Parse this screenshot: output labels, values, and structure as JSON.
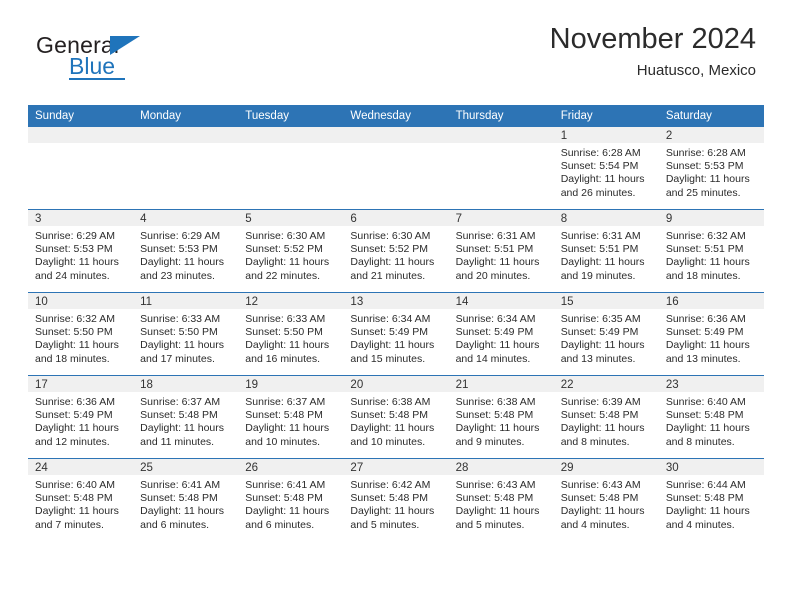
{
  "logo": {
    "word_one": "General",
    "word_two": "Blue",
    "flag_icon": "triangle-flag-icon",
    "accent_color": "#1f74bb"
  },
  "header": {
    "month_title": "November 2024",
    "location": "Huatusco, Mexico"
  },
  "calendar": {
    "header_bg": "#2d74b5",
    "daynum_band_bg": "#f0f0f0",
    "weekdays": [
      "Sunday",
      "Monday",
      "Tuesday",
      "Wednesday",
      "Thursday",
      "Friday",
      "Saturday"
    ],
    "labels": {
      "sunrise": "Sunrise:",
      "sunset": "Sunset:",
      "daylight": "Daylight:"
    },
    "weeks": [
      [
        {
          "day": "",
          "blank": true
        },
        {
          "day": "",
          "blank": true
        },
        {
          "day": "",
          "blank": true
        },
        {
          "day": "",
          "blank": true
        },
        {
          "day": "",
          "blank": true
        },
        {
          "day": "1",
          "sunrise": "Sunrise: 6:28 AM",
          "sunset": "Sunset: 5:54 PM",
          "daylight_1": "Daylight: 11 hours",
          "daylight_2": "and 26 minutes."
        },
        {
          "day": "2",
          "sunrise": "Sunrise: 6:28 AM",
          "sunset": "Sunset: 5:53 PM",
          "daylight_1": "Daylight: 11 hours",
          "daylight_2": "and 25 minutes."
        }
      ],
      [
        {
          "day": "3",
          "sunrise": "Sunrise: 6:29 AM",
          "sunset": "Sunset: 5:53 PM",
          "daylight_1": "Daylight: 11 hours",
          "daylight_2": "and 24 minutes."
        },
        {
          "day": "4",
          "sunrise": "Sunrise: 6:29 AM",
          "sunset": "Sunset: 5:53 PM",
          "daylight_1": "Daylight: 11 hours",
          "daylight_2": "and 23 minutes."
        },
        {
          "day": "5",
          "sunrise": "Sunrise: 6:30 AM",
          "sunset": "Sunset: 5:52 PM",
          "daylight_1": "Daylight: 11 hours",
          "daylight_2": "and 22 minutes."
        },
        {
          "day": "6",
          "sunrise": "Sunrise: 6:30 AM",
          "sunset": "Sunset: 5:52 PM",
          "daylight_1": "Daylight: 11 hours",
          "daylight_2": "and 21 minutes."
        },
        {
          "day": "7",
          "sunrise": "Sunrise: 6:31 AM",
          "sunset": "Sunset: 5:51 PM",
          "daylight_1": "Daylight: 11 hours",
          "daylight_2": "and 20 minutes."
        },
        {
          "day": "8",
          "sunrise": "Sunrise: 6:31 AM",
          "sunset": "Sunset: 5:51 PM",
          "daylight_1": "Daylight: 11 hours",
          "daylight_2": "and 19 minutes."
        },
        {
          "day": "9",
          "sunrise": "Sunrise: 6:32 AM",
          "sunset": "Sunset: 5:51 PM",
          "daylight_1": "Daylight: 11 hours",
          "daylight_2": "and 18 minutes."
        }
      ],
      [
        {
          "day": "10",
          "sunrise": "Sunrise: 6:32 AM",
          "sunset": "Sunset: 5:50 PM",
          "daylight_1": "Daylight: 11 hours",
          "daylight_2": "and 18 minutes."
        },
        {
          "day": "11",
          "sunrise": "Sunrise: 6:33 AM",
          "sunset": "Sunset: 5:50 PM",
          "daylight_1": "Daylight: 11 hours",
          "daylight_2": "and 17 minutes."
        },
        {
          "day": "12",
          "sunrise": "Sunrise: 6:33 AM",
          "sunset": "Sunset: 5:50 PM",
          "daylight_1": "Daylight: 11 hours",
          "daylight_2": "and 16 minutes."
        },
        {
          "day": "13",
          "sunrise": "Sunrise: 6:34 AM",
          "sunset": "Sunset: 5:49 PM",
          "daylight_1": "Daylight: 11 hours",
          "daylight_2": "and 15 minutes."
        },
        {
          "day": "14",
          "sunrise": "Sunrise: 6:34 AM",
          "sunset": "Sunset: 5:49 PM",
          "daylight_1": "Daylight: 11 hours",
          "daylight_2": "and 14 minutes."
        },
        {
          "day": "15",
          "sunrise": "Sunrise: 6:35 AM",
          "sunset": "Sunset: 5:49 PM",
          "daylight_1": "Daylight: 11 hours",
          "daylight_2": "and 13 minutes."
        },
        {
          "day": "16",
          "sunrise": "Sunrise: 6:36 AM",
          "sunset": "Sunset: 5:49 PM",
          "daylight_1": "Daylight: 11 hours",
          "daylight_2": "and 13 minutes."
        }
      ],
      [
        {
          "day": "17",
          "sunrise": "Sunrise: 6:36 AM",
          "sunset": "Sunset: 5:49 PM",
          "daylight_1": "Daylight: 11 hours",
          "daylight_2": "and 12 minutes."
        },
        {
          "day": "18",
          "sunrise": "Sunrise: 6:37 AM",
          "sunset": "Sunset: 5:48 PM",
          "daylight_1": "Daylight: 11 hours",
          "daylight_2": "and 11 minutes."
        },
        {
          "day": "19",
          "sunrise": "Sunrise: 6:37 AM",
          "sunset": "Sunset: 5:48 PM",
          "daylight_1": "Daylight: 11 hours",
          "daylight_2": "and 10 minutes."
        },
        {
          "day": "20",
          "sunrise": "Sunrise: 6:38 AM",
          "sunset": "Sunset: 5:48 PM",
          "daylight_1": "Daylight: 11 hours",
          "daylight_2": "and 10 minutes."
        },
        {
          "day": "21",
          "sunrise": "Sunrise: 6:38 AM",
          "sunset": "Sunset: 5:48 PM",
          "daylight_1": "Daylight: 11 hours",
          "daylight_2": "and 9 minutes."
        },
        {
          "day": "22",
          "sunrise": "Sunrise: 6:39 AM",
          "sunset": "Sunset: 5:48 PM",
          "daylight_1": "Daylight: 11 hours",
          "daylight_2": "and 8 minutes."
        },
        {
          "day": "23",
          "sunrise": "Sunrise: 6:40 AM",
          "sunset": "Sunset: 5:48 PM",
          "daylight_1": "Daylight: 11 hours",
          "daylight_2": "and 8 minutes."
        }
      ],
      [
        {
          "day": "24",
          "sunrise": "Sunrise: 6:40 AM",
          "sunset": "Sunset: 5:48 PM",
          "daylight_1": "Daylight: 11 hours",
          "daylight_2": "and 7 minutes."
        },
        {
          "day": "25",
          "sunrise": "Sunrise: 6:41 AM",
          "sunset": "Sunset: 5:48 PM",
          "daylight_1": "Daylight: 11 hours",
          "daylight_2": "and 6 minutes."
        },
        {
          "day": "26",
          "sunrise": "Sunrise: 6:41 AM",
          "sunset": "Sunset: 5:48 PM",
          "daylight_1": "Daylight: 11 hours",
          "daylight_2": "and 6 minutes."
        },
        {
          "day": "27",
          "sunrise": "Sunrise: 6:42 AM",
          "sunset": "Sunset: 5:48 PM",
          "daylight_1": "Daylight: 11 hours",
          "daylight_2": "and 5 minutes."
        },
        {
          "day": "28",
          "sunrise": "Sunrise: 6:43 AM",
          "sunset": "Sunset: 5:48 PM",
          "daylight_1": "Daylight: 11 hours",
          "daylight_2": "and 5 minutes."
        },
        {
          "day": "29",
          "sunrise": "Sunrise: 6:43 AM",
          "sunset": "Sunset: 5:48 PM",
          "daylight_1": "Daylight: 11 hours",
          "daylight_2": "and 4 minutes."
        },
        {
          "day": "30",
          "sunrise": "Sunrise: 6:44 AM",
          "sunset": "Sunset: 5:48 PM",
          "daylight_1": "Daylight: 11 hours",
          "daylight_2": "and 4 minutes."
        }
      ]
    ]
  }
}
